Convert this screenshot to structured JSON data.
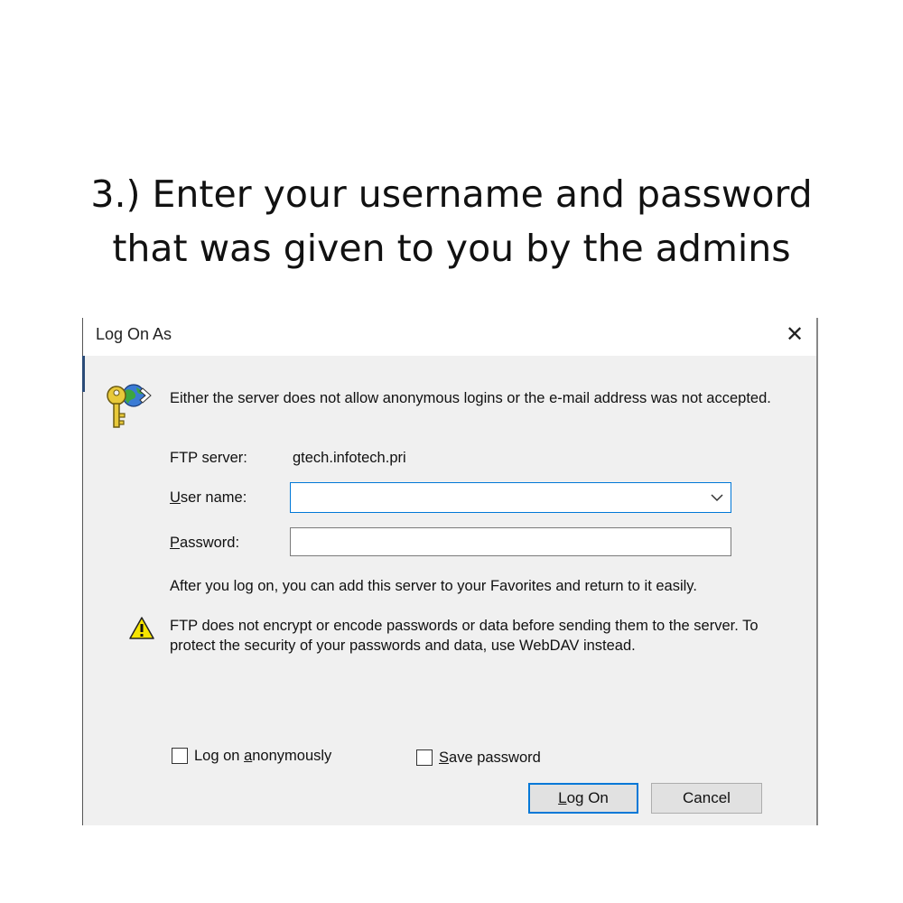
{
  "caption": {
    "line1": "3.) Enter your username and password",
    "line2": "that was given to you by the admins"
  },
  "dialog": {
    "title": "Log On As",
    "close_glyph": "✕",
    "message": "Either the server does not allow anonymous logins or the e-mail address was not accepted.",
    "ftp_server_label": "FTP server:",
    "ftp_server_value": "gtech.infotech.pri",
    "username_label_key": "U",
    "username_label_rest": "ser name:",
    "username_value": "",
    "password_label_key": "P",
    "password_label_rest": "assword:",
    "password_value": "",
    "favorites_note": "After you log on, you can add this server to your Favorites and return to it easily.",
    "warning_text": "FTP does not encrypt or encode passwords or data before sending them to the server.  To protect the security of your passwords and data, use WebDAV instead.",
    "anon_label_pre": "Log on ",
    "anon_label_key": "a",
    "anon_label_post": "nonymously",
    "anon_checked": false,
    "save_label_key": "S",
    "save_label_rest": "ave password",
    "save_checked": false,
    "logon_key": "L",
    "logon_rest": "og On",
    "cancel_label": "Cancel",
    "icons": {
      "key": "key-globe-icon",
      "warning": "warning-icon",
      "chevron": "chevron-down-icon",
      "close": "close-icon"
    },
    "colors": {
      "focus_border": "#0078d7",
      "warning_yellow": "#f5e400"
    }
  }
}
